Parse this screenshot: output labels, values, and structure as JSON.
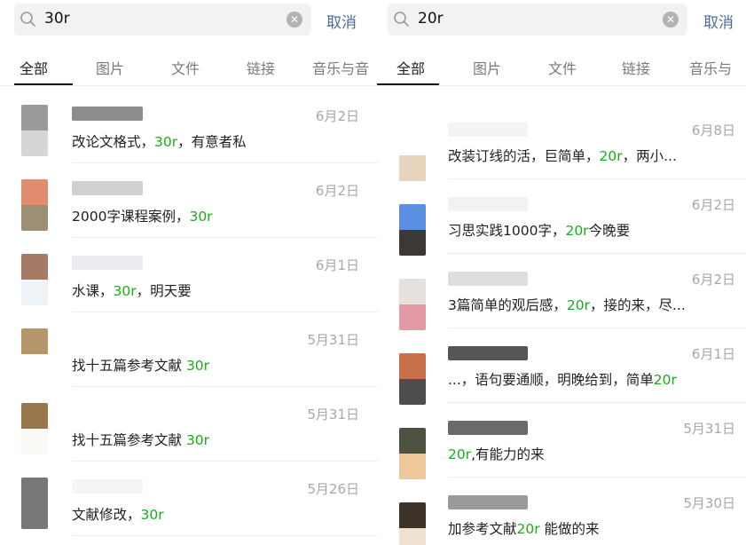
{
  "left": {
    "search": {
      "query": "30r",
      "clear_icon": "clear-icon",
      "cancel_label": "取消"
    },
    "tabs": [
      "全部",
      "图片",
      "文件",
      "链接",
      "音乐与音"
    ],
    "results": [
      {
        "date": "6月2日",
        "msg_parts": [
          {
            "t": "改论文格式，",
            "hl": false
          },
          {
            "t": "30r",
            "hl": true
          },
          {
            "t": "，有意者私",
            "hl": false
          }
        ],
        "avatar_top": "#9a9a9a",
        "avatar_bottom": "#d6d6d6",
        "name_blur": "#8c8c8c"
      },
      {
        "date": "6月2日",
        "msg_parts": [
          {
            "t": "2000字课程案例，",
            "hl": false
          },
          {
            "t": "30r",
            "hl": true
          }
        ],
        "avatar_top": "#e08c6e",
        "avatar_bottom": "#9c8f75",
        "name_blur": "#d0d0d0"
      },
      {
        "date": "6月1日",
        "msg_parts": [
          {
            "t": "水课，",
            "hl": false
          },
          {
            "t": "30r",
            "hl": true
          },
          {
            "t": "，明天要",
            "hl": false
          }
        ],
        "avatar_top": "#a67b65",
        "avatar_bottom": "#eef3f7",
        "name_blur": "#ececf2"
      },
      {
        "date": "5月31日",
        "msg_parts": [
          {
            "t": "找十五篇参考文献 ",
            "hl": false
          },
          {
            "t": "30r",
            "hl": true
          }
        ],
        "avatar_top": "#b5966a",
        "avatar_bottom": "#ffffff",
        "name_blur": "#ffffff"
      },
      {
        "date": "5月31日",
        "msg_parts": [
          {
            "t": "找十五篇参考文献 ",
            "hl": false
          },
          {
            "t": "30r",
            "hl": true
          }
        ],
        "avatar_top": "#98774f",
        "avatar_bottom": "#fbf9f6",
        "name_blur": "#ffffff"
      },
      {
        "date": "5月26日",
        "msg_parts": [
          {
            "t": "文献修改，",
            "hl": false
          },
          {
            "t": "30r",
            "hl": true
          }
        ],
        "avatar_top": "#777777",
        "avatar_bottom": "#777777",
        "name_blur": "#f5f5f5"
      }
    ]
  },
  "right": {
    "search": {
      "query": "20r",
      "clear_icon": "clear-icon",
      "cancel_label": "取消"
    },
    "tabs": [
      "全部",
      "图片",
      "文件",
      "链接",
      "音乐与"
    ],
    "results": [
      {
        "date": "6月8日",
        "msg_parts": [
          {
            "t": "改装订线的活，巨简单，",
            "hl": false
          },
          {
            "t": "20r",
            "hl": true
          },
          {
            "t": "，两小...",
            "hl": false
          }
        ],
        "avatar_top": "#ffffff",
        "avatar_bottom": "#e7d5bd",
        "name_blur": "#f3f3f3"
      },
      {
        "date": "6月2日",
        "msg_parts": [
          {
            "t": "习思实践1000字，",
            "hl": false
          },
          {
            "t": "20r",
            "hl": true
          },
          {
            "t": "今晚要",
            "hl": false
          }
        ],
        "avatar_top": "#5b8fe0",
        "avatar_bottom": "#3b3835",
        "name_blur": "#f2f2f2"
      },
      {
        "date": "6月2日",
        "msg_parts": [
          {
            "t": "3篇简单的观后感，",
            "hl": false
          },
          {
            "t": "20r",
            "hl": true
          },
          {
            "t": "，接的来，尽...",
            "hl": false
          }
        ],
        "avatar_top": "#e6e1dc",
        "avatar_bottom": "#e29aa6",
        "name_blur": "#dedede"
      },
      {
        "date": "6月1日",
        "msg_parts": [
          {
            "t": "...，语句要通顺，明晚给到，简单",
            "hl": false
          },
          {
            "t": "20r",
            "hl": true
          }
        ],
        "avatar_top": "#c8704a",
        "avatar_bottom": "#4d4d4d",
        "name_blur": "#555555"
      },
      {
        "date": "5月31日",
        "msg_parts": [
          {
            "t": "20r",
            "hl": true
          },
          {
            "t": ",有能力的来",
            "hl": false
          }
        ],
        "avatar_top": "#4e5240",
        "avatar_bottom": "#eec79a",
        "name_blur": "#6a6a6a"
      },
      {
        "date": "5月30日",
        "msg_parts": [
          {
            "t": "加参考文献",
            "hl": false
          },
          {
            "t": "20r",
            "hl": true
          },
          {
            "t": " 能做的来",
            "hl": false
          }
        ],
        "avatar_top": "#3c3228",
        "avatar_bottom": "#efe2d0",
        "name_blur": "#9a9a9a"
      }
    ]
  }
}
